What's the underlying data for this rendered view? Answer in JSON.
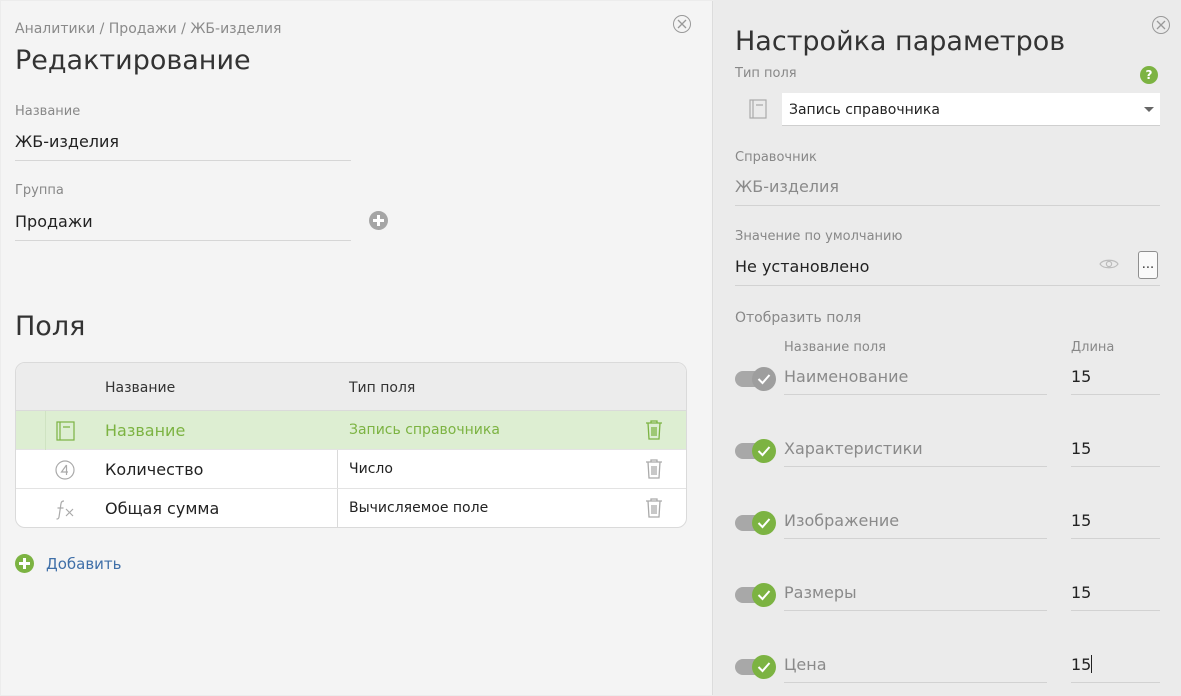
{
  "editor": {
    "breadcrumb": "Аналитики / Продажи / ЖБ-изделия",
    "title": "Редактирование",
    "name_label": "Название",
    "name_value": "ЖБ-изделия",
    "group_label": "Группа",
    "group_value": "Продажи",
    "fields_title": "Поля",
    "table": {
      "headers": [
        "Название",
        "Тип поля"
      ],
      "rows": [
        {
          "icon": "reference-record-icon",
          "name": "Название",
          "type": "Запись справочника",
          "selected": true
        },
        {
          "icon": "number-icon",
          "name": "Количество",
          "type": "Число",
          "selected": false
        },
        {
          "icon": "formula-icon",
          "name": "Общая сумма",
          "type": "Вычисляемое поле",
          "selected": false
        }
      ]
    },
    "add_label": "Добавить"
  },
  "settings": {
    "title": "Настройка параметров",
    "field_type_label": "Тип поля",
    "field_type_value": "Запись справочника",
    "reference_label": "Справочник",
    "reference_value": "ЖБ-изделия",
    "default_label": "Значение по умолчанию",
    "default_value": "Не установлено",
    "more_button": "...",
    "display_fields_label": "Отобразить поля",
    "col_name": "Название поля",
    "col_length": "Длина",
    "fields": [
      {
        "name": "Наименование",
        "length": "15",
        "state": "semi"
      },
      {
        "name": "Характеристики",
        "length": "15",
        "state": "on"
      },
      {
        "name": "Изображение",
        "length": "15",
        "state": "on"
      },
      {
        "name": "Размеры",
        "length": "15",
        "state": "on"
      },
      {
        "name": "Цена",
        "length": "15",
        "state": "on"
      }
    ]
  },
  "colors": {
    "accent": "#7cb342",
    "selected_row": "#ddeed2",
    "link": "#3f6fa8"
  }
}
